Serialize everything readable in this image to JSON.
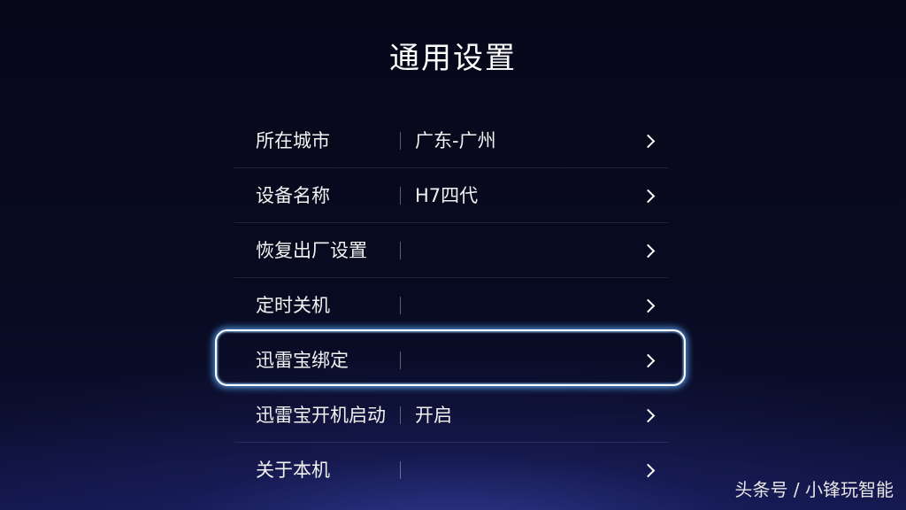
{
  "title": "通用设置",
  "settings": {
    "items": [
      {
        "label": "所在城市",
        "value": "广东-广州"
      },
      {
        "label": "设备名称",
        "value": "H7四代"
      },
      {
        "label": "恢复出厂设置",
        "value": ""
      },
      {
        "label": "定时关机",
        "value": ""
      },
      {
        "label": "迅雷宝绑定",
        "value": ""
      },
      {
        "label": "迅雷宝开机启动",
        "value": "开启"
      },
      {
        "label": "关于本机",
        "value": ""
      }
    ],
    "focused_index": 4,
    "chevron_icon": "chevron-right-icon"
  },
  "watermark": "头条号 / 小锋玩智能",
  "colors": {
    "background": "#07081a",
    "focus_glow": "#5aaaff",
    "text": "#ffffff"
  }
}
